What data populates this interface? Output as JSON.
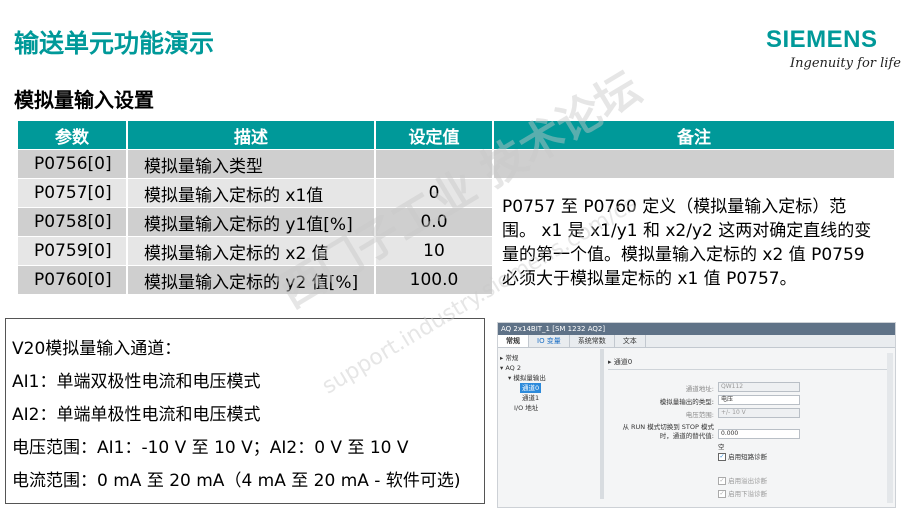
{
  "title": "输送单元功能演示",
  "logo": {
    "word": "SIEMENS",
    "tagline": "Ingenuity for life"
  },
  "subtitle": "模拟量输入设置",
  "table": {
    "headers": [
      "参数",
      "描述",
      "设定值",
      "备注"
    ],
    "rows": [
      {
        "param": "P0756[0]",
        "desc": "模拟量输入类型",
        "value": ""
      },
      {
        "param": "P0757[0]",
        "desc": "模拟量输入定标的 x1值",
        "value": "0"
      },
      {
        "param": "P0758[0]",
        "desc": "模拟量输入定标的 y1值[%]",
        "value": "0.0"
      },
      {
        "param": "P0759[0]",
        "desc": "模拟量输入定标的 x2 值",
        "value": "10"
      },
      {
        "param": "P0760[0]",
        "desc": "模拟量输入定标的 y2 值[%]",
        "value": "100.0"
      }
    ],
    "note": "P0757 至 P0760 定义（模拟量输入定标）范围。 x1 是 x1/y1 和 x2/y2 这两对确定直线的变量的第一个值。模拟量输入定标的 x2 值 P0759 必须大于模拟量定标的 x1 值 P0757。"
  },
  "panel": {
    "lines": [
      "V20模拟量输入通道：",
      "AI1：单端双极性电流和电压模式",
      "AI2：单端单极性电流和电压模式",
      "电压范围：AI1：-10 V 至 10 V；AI2：0 V 至 10 V",
      "电流范围：0 mA 至 20 mA（4 mA 至 20 mA - 软件可选)"
    ]
  },
  "screenshot": {
    "window_title": "AQ 2x14BIT_1 [SM 1232 AQ2]",
    "tabs": [
      "常规",
      "IO 变量",
      "系统常数",
      "文本"
    ],
    "tree": [
      "常规",
      "AQ 2",
      "模拟量输出",
      "通道0",
      "通道1",
      "I/O 地址"
    ],
    "channel_header": "通道0",
    "fields": {
      "address_label": "通道地址:",
      "address_value": "QW112",
      "type_label": "模拟量输出的类型:",
      "type_value": "电压",
      "range_label": "电压范围:",
      "range_value": "+/- 10 V",
      "stop_label_1": "从 RUN 模式切换到 STOP 模式",
      "stop_label_2": "时，通道的替代值:",
      "stop_value": "0.000",
      "empty_label": "空",
      "diag1": "启用短路诊断",
      "diag2": "启用溢出诊断",
      "diag3": "启用下溢诊断"
    }
  },
  "watermark": {
    "text1": "西门子工业 技术论坛",
    "text2": "support.industry.siemens.com/cs"
  },
  "colors": {
    "brand": "#009999",
    "row_light": "#e6e6e6",
    "row_dark": "#cfcfcf"
  }
}
